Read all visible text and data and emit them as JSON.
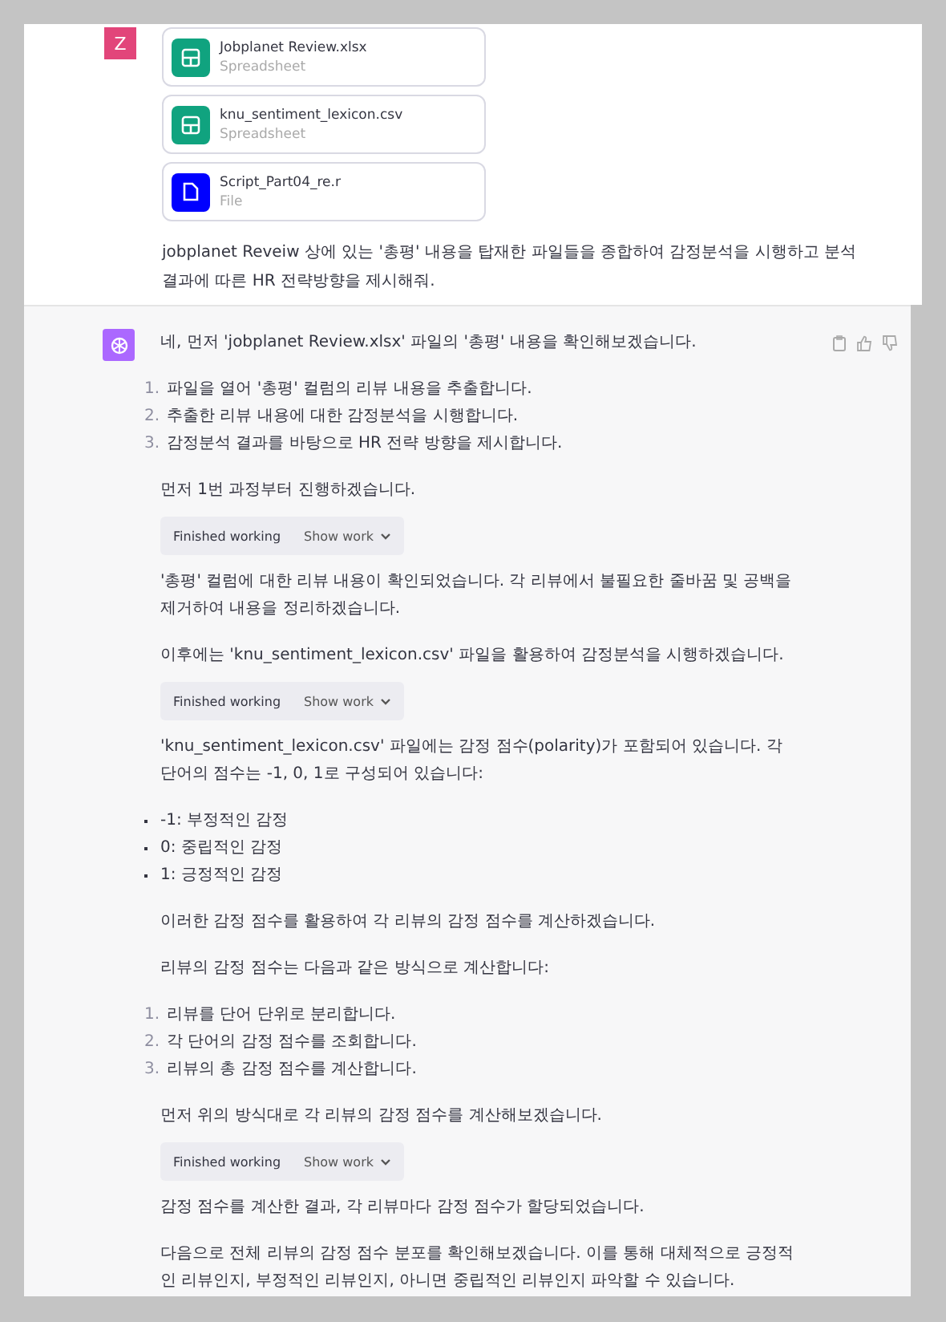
{
  "user_message": {
    "avatar": "Z",
    "files": [
      {
        "name": "Jobplanet Review.xlsx",
        "type": "Spreadsheet",
        "kind": "spreadsheet"
      },
      {
        "name": "knu_sentiment_lexicon.csv",
        "type": "Spreadsheet",
        "kind": "spreadsheet"
      },
      {
        "name": "Script_Part04_re.r",
        "type": "File",
        "kind": "file"
      }
    ],
    "text": "jobplanet Reveiw 상에 있는 '총평' 내용을 탑재한 파일들을 종합하여 감정분석을 시행하고 분석결과에 따른 HR 전략방향을 제시해줘."
  },
  "assistant_message": {
    "blocks": [
      {
        "kind": "paragraph",
        "text": "네, 먼저 'jobplanet Review.xlsx' 파일의 '총평' 내용을 확인해보겠습니다."
      },
      {
        "kind": "ordered",
        "items": [
          {
            "number": "1.",
            "text": "파일을 열어 '총평' 컬럼의 리뷰 내용을 추출합니다."
          },
          {
            "number": "2.",
            "text": "추출한 리뷰 내용에 대한 감정분석을 시행합니다."
          },
          {
            "number": "3.",
            "text": "감정분석 결과를 바탕으로 HR 전략 방향을 제시합니다."
          }
        ]
      },
      {
        "kind": "paragraph",
        "text": "먼저 1번 과정부터 진행하겠습니다."
      },
      {
        "kind": "tool",
        "status": "Finished working",
        "toggle": "Show work"
      },
      {
        "kind": "paragraph",
        "text": "'총평' 컬럼에 대한 리뷰 내용이 확인되었습니다. 각 리뷰에서 불필요한 줄바꿈 및 공백을 제거하여 내용을 정리하겠습니다."
      },
      {
        "kind": "paragraph",
        "text": "이후에는 'knu_sentiment_lexicon.csv' 파일을 활용하여 감정분석을 시행하겠습니다."
      },
      {
        "kind": "tool",
        "status": "Finished working",
        "toggle": "Show work"
      },
      {
        "kind": "paragraph",
        "text": "'knu_sentiment_lexicon.csv' 파일에는 감정 점수(polarity)가 포함되어 있습니다. 각 단어의 점수는 -1, 0, 1로 구성되어 있습니다:"
      },
      {
        "kind": "bullets",
        "items": [
          "-1: 부정적인 감정",
          "0: 중립적인 감정",
          "1: 긍정적인 감정"
        ]
      },
      {
        "kind": "paragraph",
        "text": "이러한 감정 점수를 활용하여 각 리뷰의 감정 점수를 계산하겠습니다."
      },
      {
        "kind": "paragraph",
        "text": "리뷰의 감정 점수는 다음과 같은 방식으로 계산합니다:"
      },
      {
        "kind": "ordered",
        "items": [
          {
            "number": "1.",
            "text": "리뷰를 단어 단위로 분리합니다."
          },
          {
            "number": "2.",
            "text": "각 단어의 감정 점수를 조회합니다."
          },
          {
            "number": "3.",
            "text": "리뷰의 총 감정 점수를 계산합니다."
          }
        ]
      },
      {
        "kind": "paragraph",
        "text": "먼저 위의 방식대로 각 리뷰의 감정 점수를 계산해보겠습니다."
      },
      {
        "kind": "tool",
        "status": "Finished working",
        "toggle": "Show work"
      },
      {
        "kind": "paragraph",
        "text": "감정 점수를 계산한 결과, 각 리뷰마다 감정 점수가 할당되었습니다."
      },
      {
        "kind": "paragraph",
        "text": "다음으로 전체 리뷰의 감정 점수 분포를 확인해보겠습니다. 이를 통해 대체적으로 긍정적인 리뷰인지, 부정적인 리뷰인지, 아니면 중립적인 리뷰인지 파악할 수 있습니다."
      }
    ]
  }
}
